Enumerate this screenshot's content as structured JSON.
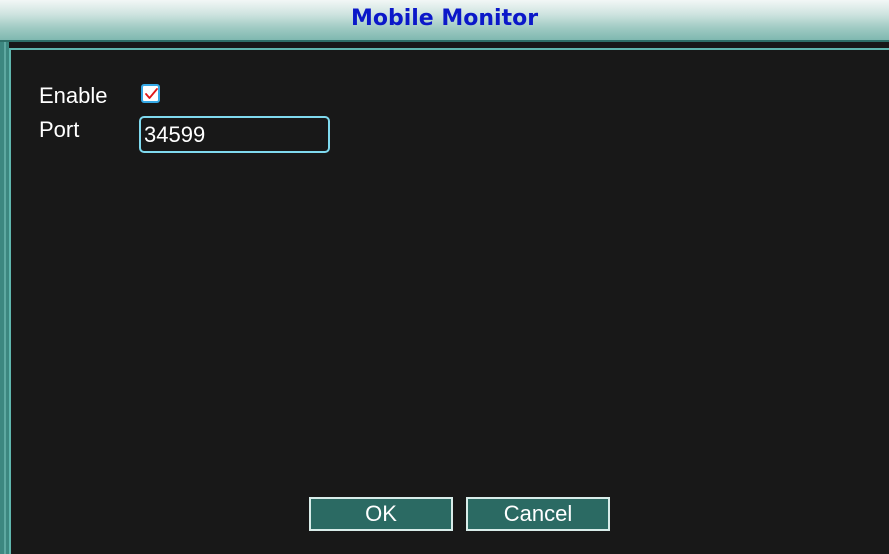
{
  "window": {
    "title": "Mobile Monitor"
  },
  "form": {
    "enable_label": "Enable",
    "enable_checked": true,
    "port_label": "Port",
    "port_value": "34599"
  },
  "buttons": {
    "ok_label": "OK",
    "cancel_label": "Cancel"
  },
  "colors": {
    "title_text": "#0b18c9",
    "background": "#181818",
    "accent": "#5fb5ad",
    "button_bg": "#2b6a63",
    "checkmark": "#e01818"
  },
  "icons": {
    "checkbox": "checkmark-icon"
  }
}
